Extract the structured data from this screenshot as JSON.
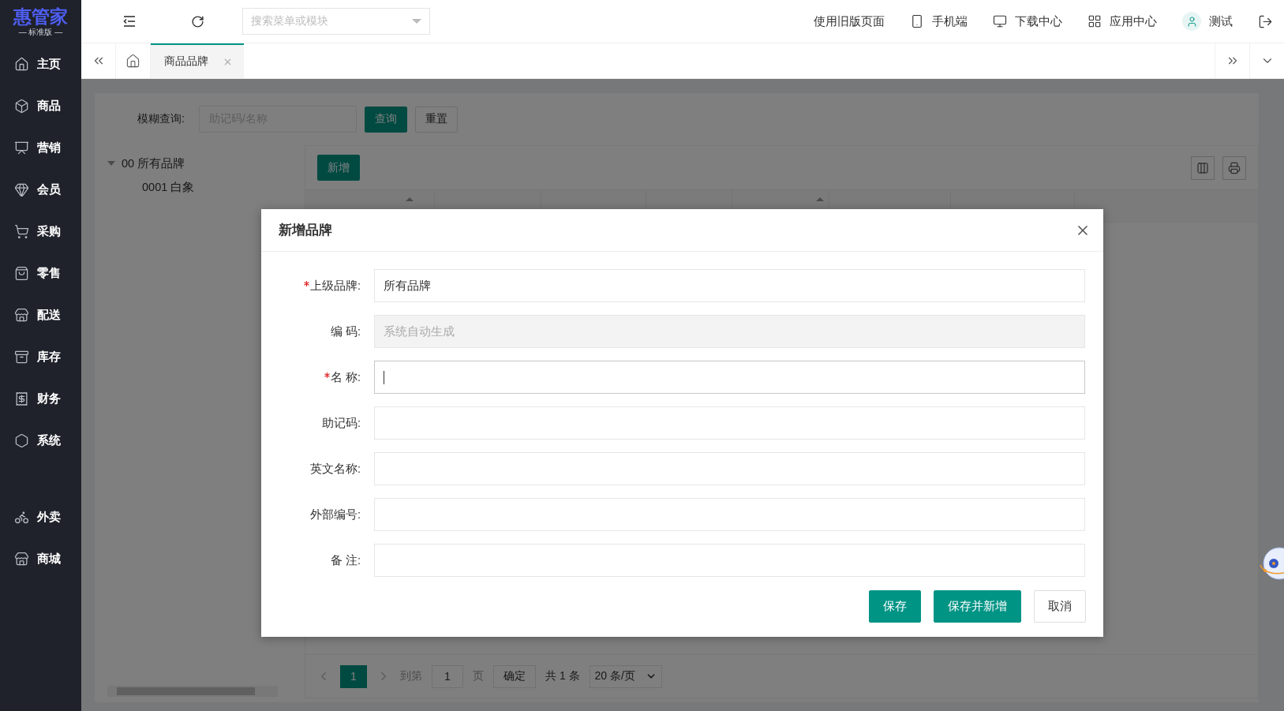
{
  "sidebar": {
    "logo": "惠管家",
    "edition": "— 标准版 —",
    "items": [
      {
        "label": "主页"
      },
      {
        "label": "商品"
      },
      {
        "label": "营销"
      },
      {
        "label": "会员"
      },
      {
        "label": "采购"
      },
      {
        "label": "零售"
      },
      {
        "label": "配送"
      },
      {
        "label": "库存"
      },
      {
        "label": "财务"
      },
      {
        "label": "系统"
      }
    ],
    "extra_items": [
      {
        "label": "外卖"
      },
      {
        "label": "商城"
      }
    ]
  },
  "header": {
    "search": {
      "placeholder": "搜索菜单或模块"
    },
    "links": [
      {
        "label": "使用旧版页面"
      },
      {
        "label": "手机端"
      },
      {
        "label": "下载中心"
      },
      {
        "label": "应用中心"
      },
      {
        "label": "测试"
      }
    ]
  },
  "tabs": [
    {
      "label": "商品品牌",
      "selected": true
    }
  ],
  "filter": {
    "label": "模糊查询:",
    "placeholder": "助记码/名称",
    "buttons": [
      {
        "label": "查询",
        "primary": true
      },
      {
        "label": "重置",
        "primary": false
      }
    ]
  },
  "tree": [
    {
      "label": "00 所有品牌",
      "expanded": true,
      "children": [
        {
          "label": "0001 白象"
        }
      ]
    }
  ],
  "table": {
    "add_button": "新增",
    "columns": [
      {
        "sortable": true
      },
      {
        "sortable": false
      },
      {
        "sortable": false
      },
      {
        "sortable": false
      },
      {
        "sortable": true
      },
      {
        "sortable": false
      },
      {
        "sortable": false
      }
    ]
  },
  "pagination": {
    "pages": [
      {
        "label": "1",
        "selected": true
      }
    ],
    "goto_label": "到第",
    "goto_value": "1",
    "page_label": "页",
    "confirm": "确定",
    "total": "共 1 条",
    "page_size": "20 条/页"
  },
  "dialog": {
    "title": "新增品牌",
    "fields": [
      {
        "label": "上级品牌:",
        "required": true,
        "value": "所有品牌",
        "disabled": false,
        "focused": false
      },
      {
        "label": "编 码:",
        "required": false,
        "placeholder": "系统自动生成",
        "disabled": true,
        "focused": false
      },
      {
        "label": "名 称:",
        "required": true,
        "disabled": false,
        "focused": true
      },
      {
        "label": "助记码:",
        "required": false,
        "disabled": false,
        "focused": false
      },
      {
        "label": "英文名称:",
        "required": false,
        "disabled": false,
        "focused": false
      },
      {
        "label": "外部编号:",
        "required": false,
        "disabled": false,
        "focused": false
      },
      {
        "label": "备 注:",
        "required": false,
        "disabled": false,
        "focused": false
      }
    ],
    "buttons": [
      {
        "label": "保存",
        "primary": true
      },
      {
        "label": "保存并新增",
        "primary": true
      },
      {
        "label": "取消",
        "primary": false
      }
    ]
  }
}
